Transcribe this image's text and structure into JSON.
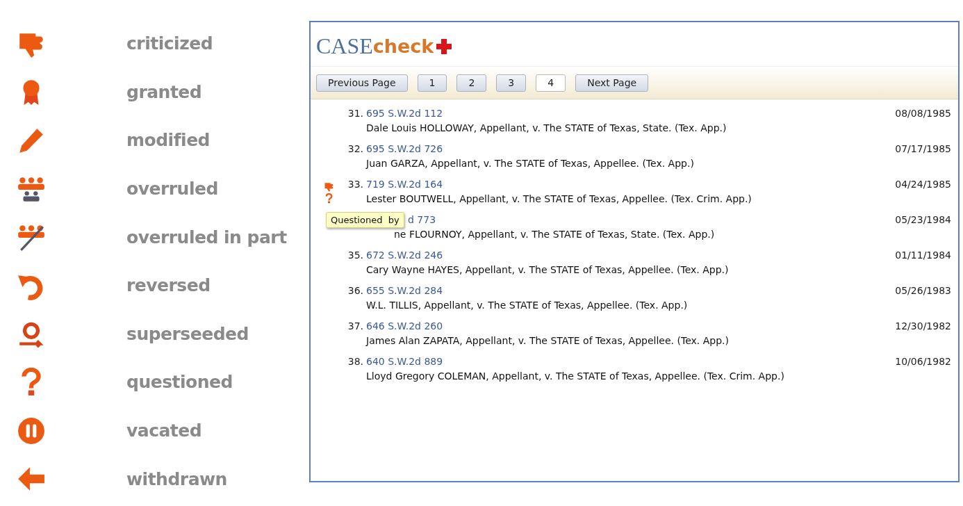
{
  "legend": [
    {
      "kind": "criticized",
      "label": "criticized"
    },
    {
      "kind": "granted",
      "label": "granted"
    },
    {
      "kind": "modified",
      "label": "modified"
    },
    {
      "kind": "overruled",
      "label": "overruled"
    },
    {
      "kind": "overruled_part",
      "label": "overruled in part"
    },
    {
      "kind": "reversed",
      "label": "reversed"
    },
    {
      "kind": "superseded",
      "label": "superseeded"
    },
    {
      "kind": "questioned",
      "label": "questioned"
    },
    {
      "kind": "vacated",
      "label": "vacated"
    },
    {
      "kind": "withdrawn",
      "label": "withdrawn"
    }
  ],
  "app": {
    "logo_main": "CASE",
    "logo_accent": "check",
    "pager": [
      {
        "label": "Previous Page",
        "selected": false
      },
      {
        "label": "1",
        "selected": false
      },
      {
        "label": "2",
        "selected": false
      },
      {
        "label": "3",
        "selected": false
      },
      {
        "label": "4",
        "selected": true
      },
      {
        "label": "Next Page",
        "selected": false
      }
    ],
    "rows": [
      {
        "number": "31.",
        "citation": "695 S.W.2d 112",
        "parties": "Dale Louis HOLLOWAY, Appellant, v. The STATE of Texas, State. (Tex. App.)",
        "date": "08/08/1985",
        "markers": [],
        "partial": false
      },
      {
        "number": "32.",
        "citation": "695 S.W.2d 726",
        "parties": "Juan GARZA, Appellant, v. The STATE of Texas, Appellee. (Tex. App.)",
        "date": "07/17/1985",
        "markers": [],
        "partial": false
      },
      {
        "number": "33.",
        "citation": "719 S.W.2d 164",
        "parties": "Lester BOUTWELL, Appellant, v. The STATE of Texas, Appellee. (Tex. Crim. App.)",
        "date": "04/24/1985",
        "markers": [
          {
            "kind": "criticized"
          },
          {
            "kind": "questioned"
          }
        ],
        "partial": false
      },
      {
        "number": "",
        "citation": "d 773",
        "parties": "ne FLOURNOY, Appellant, v. The STATE of Texas, State. (Tex. App.)",
        "date": "05/23/1984",
        "markers": [],
        "partial": true
      },
      {
        "number": "35.",
        "citation": "672 S.W.2d 246",
        "parties": "Cary Wayne HAYES, Appellant, v. The STATE of Texas, Appellee. (Tex. App.)",
        "date": "01/11/1984",
        "markers": [],
        "partial": false
      },
      {
        "number": "36.",
        "citation": "655 S.W.2d 284",
        "parties": "W.L. TILLIS, Appellant, v. The STATE of Texas, Appellee. (Tex. App.)",
        "date": "05/26/1983",
        "markers": [],
        "partial": false
      },
      {
        "number": "37.",
        "citation": "646 S.W.2d 260",
        "parties": "James Alan ZAPATA, Appellant, v. The STATE of Texas, Appellee. (Tex. App.)",
        "date": "12/30/1982",
        "markers": [],
        "partial": false
      },
      {
        "number": "38.",
        "citation": "640 S.W.2d 889",
        "parties": "Lloyd Gregory COLEMAN, Appellant, v. The STATE of Texas, Appellee. (Tex. Crim. App.)",
        "date": "10/06/1982",
        "markers": [],
        "partial": false
      }
    ],
    "tooltip": "Questioned  by"
  }
}
